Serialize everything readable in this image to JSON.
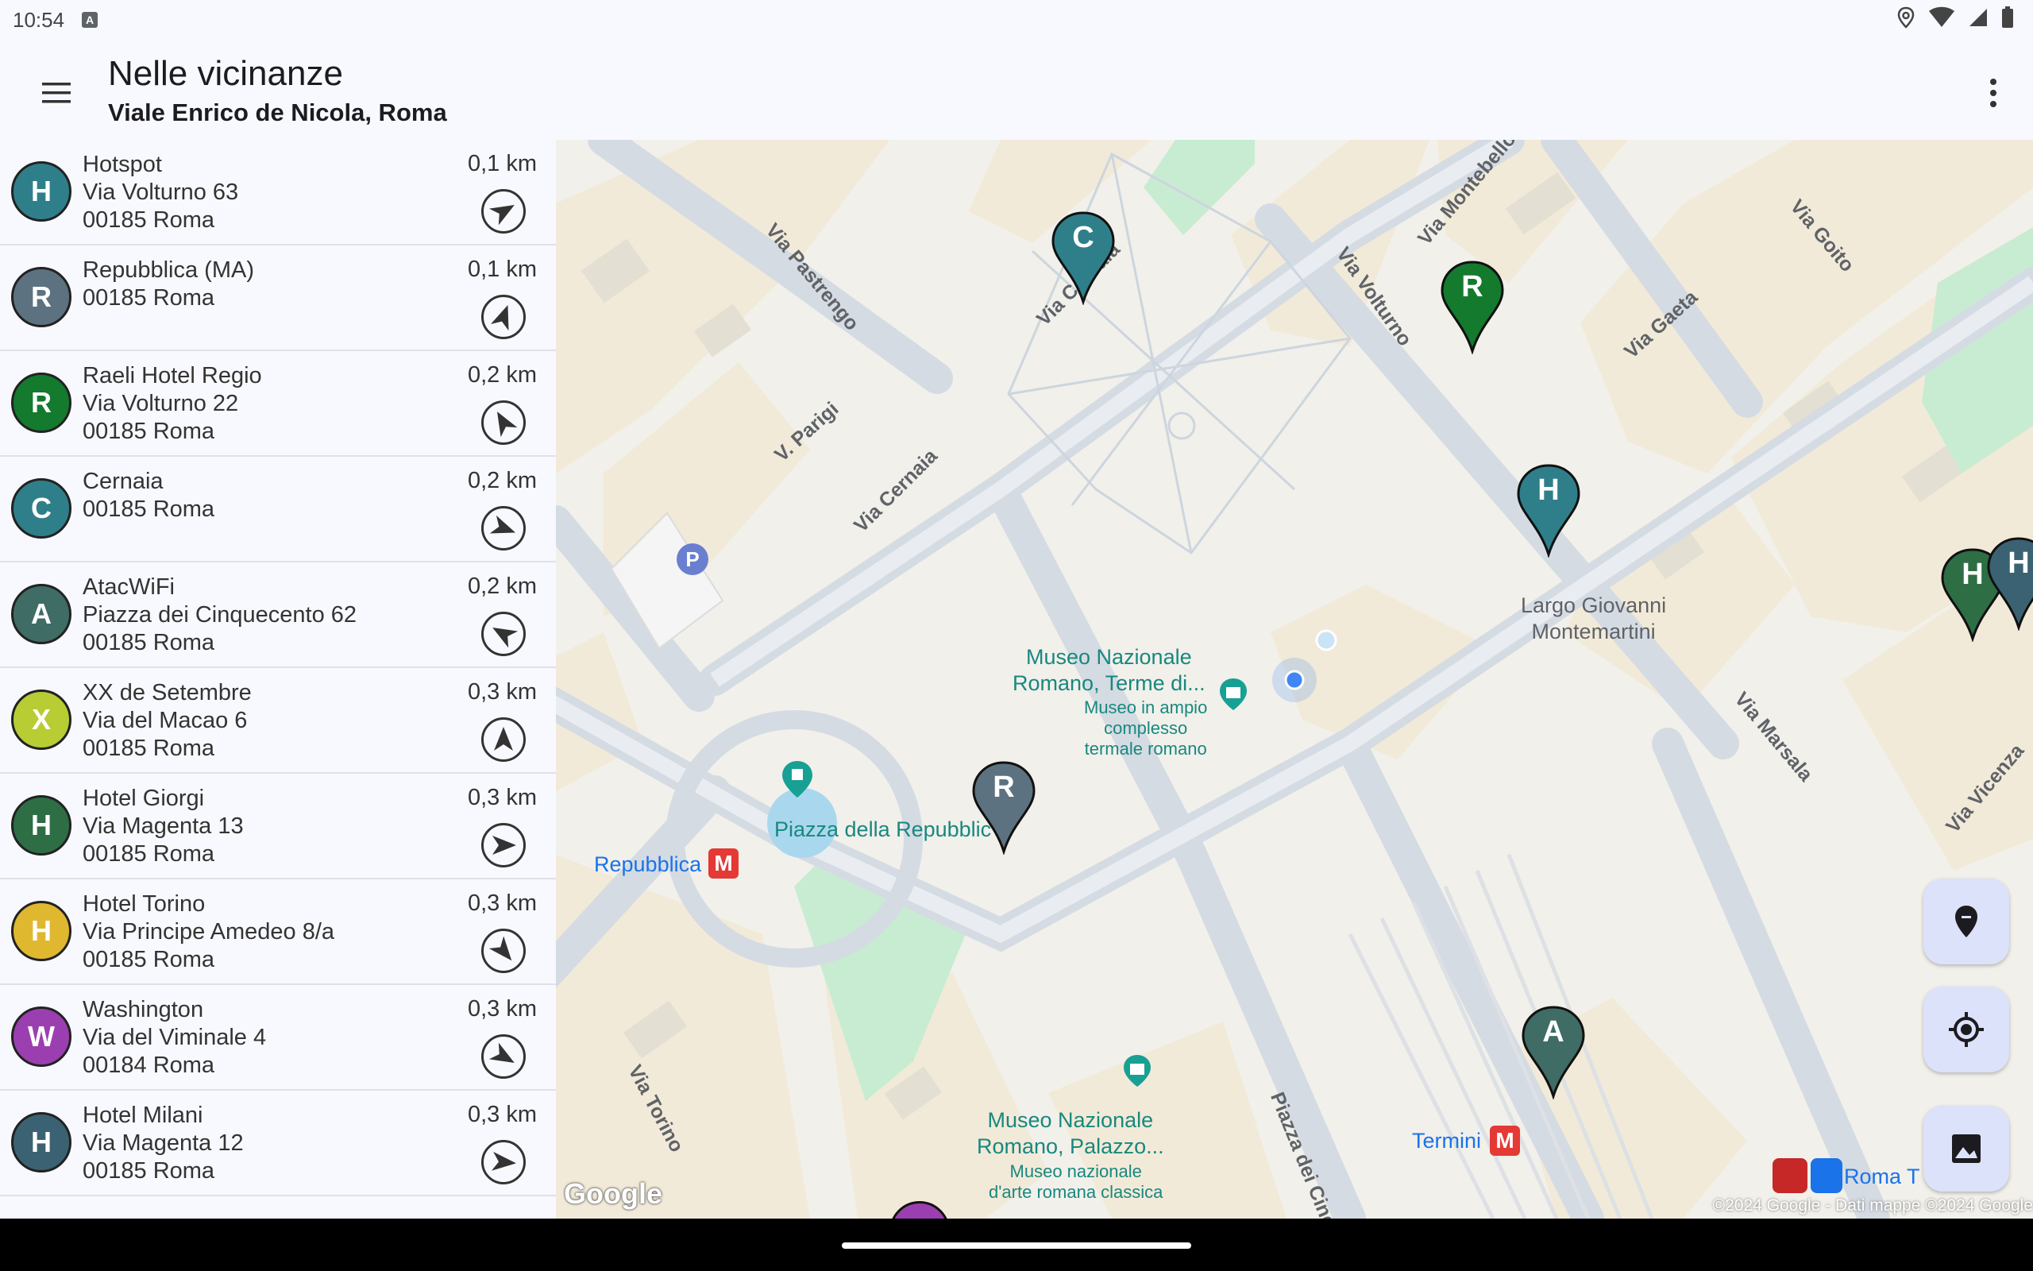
{
  "status_bar": {
    "time": "10:54",
    "notification_icon": "A"
  },
  "header": {
    "title": "Nelle vicinanze",
    "subtitle": "Viale Enrico de Nicola, Roma"
  },
  "places": [
    {
      "letter": "H",
      "color": "#2f7f8a",
      "name": "Hotspot",
      "line2": "Via Volturno 63",
      "line3": "00185 Roma",
      "distance": "0,1 km",
      "bearing": 60
    },
    {
      "letter": "R",
      "color": "#5d7280",
      "name": "Repubblica (MA)",
      "line2": "00185 Roma",
      "line3": "",
      "distance": "0,1 km",
      "bearing": 20
    },
    {
      "letter": "R",
      "color": "#137a2e",
      "name": "Raeli Hotel Regio",
      "line2": "Via Volturno 22",
      "line3": "00185 Roma",
      "distance": "0,2 km",
      "bearing": -30
    },
    {
      "letter": "C",
      "color": "#2f7f8a",
      "name": "Cernaia",
      "line2": "00185 Roma",
      "line3": "",
      "distance": "0,2 km",
      "bearing": 110
    },
    {
      "letter": "A",
      "color": "#3f6c64",
      "name": "AtacWiFi",
      "line2": "Piazza dei Cinquecento 62",
      "line3": "00185 Roma",
      "distance": "0,2 km",
      "bearing": -60
    },
    {
      "letter": "X",
      "color": "#b8cc33",
      "name": "XX de Setembre",
      "line2": "Via del Macao 6",
      "line3": "00185 Roma",
      "distance": "0,3 km",
      "bearing": 0
    },
    {
      "letter": "H",
      "color": "#2e6e45",
      "name": "Hotel Giorgi",
      "line2": "Via Magenta 13",
      "line3": "00185 Roma",
      "distance": "0,3 km",
      "bearing": 90
    },
    {
      "letter": "H",
      "color": "#e0b830",
      "name": "Hotel Torino",
      "line2": "Via Principe Amedeo 8/a",
      "line3": "00185 Roma",
      "distance": "0,3 km",
      "bearing": 140
    },
    {
      "letter": "W",
      "color": "#9b3fb0",
      "name": "Washington",
      "line2": "Via del Viminale 4",
      "line3": "00184 Roma",
      "distance": "0,3 km",
      "bearing": 120
    },
    {
      "letter": "H",
      "color": "#3b6272",
      "name": "Hotel Milani",
      "line2": "Via Magenta 12",
      "line3": "00185 Roma",
      "distance": "0,3 km",
      "bearing": 95
    }
  ],
  "map": {
    "streets": [
      "Via Pastrengo",
      "Via Cernaia",
      "V. Parigi",
      "Via Cernaia",
      "Via Volturno",
      "Via Montebello",
      "Via Gaeta",
      "Via Goito",
      "Via Marsala",
      "Via Vicenza",
      "Via Torino",
      "Piazza dei Cinq"
    ],
    "places": {
      "largo": [
        "Largo Giovanni",
        "Montemartini"
      ],
      "museo1_title": [
        "Museo Nazionale",
        "Romano, Terme di..."
      ],
      "museo1_desc": [
        "Museo in ampio",
        "complesso",
        "termale romano"
      ],
      "museo2_title": [
        "Museo Nazionale",
        "Romano, Palazzo..."
      ],
      "museo2_desc": [
        "Museo nazionale",
        "d'arte romana classica"
      ],
      "piazza": "Piazza della Repubblic",
      "metro_repubblica": "Repubblica",
      "metro_termini": "Termini",
      "roma_t": "Roma T",
      "parking": "P",
      "metro_symbol": "M"
    },
    "pins": [
      {
        "letter": "C",
        "color": "#2f7f8a"
      },
      {
        "letter": "R",
        "color": "#137a2e"
      },
      {
        "letter": "H",
        "color": "#2f7f8a"
      },
      {
        "letter": "H",
        "color": "#2e6e45"
      },
      {
        "letter": "H",
        "color": "#3b6272"
      },
      {
        "letter": "R",
        "color": "#5d7280"
      },
      {
        "letter": "A",
        "color": "#3f6c64"
      }
    ],
    "copyright": "©2024 Google - Dati mappe ©2024 Google",
    "logo": "Google"
  }
}
